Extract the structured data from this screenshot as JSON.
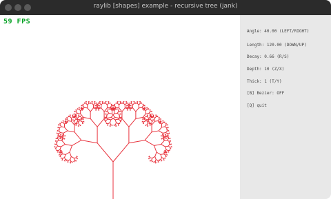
{
  "window": {
    "title": "raylib [shapes] example - recursive tree (jank)"
  },
  "fps": "59 FPS",
  "panel": {
    "lines": [
      "Angle: 40.00  (LEFT/RIGHT)",
      "Length: 120.00  (DOWN/UP)",
      "Decay: 0.66  (R/S)",
      "Depth: 10  (Z/X)",
      "Thick: 1  (T/Y)",
      "[B] Bezier: OFF",
      "[Q] quit"
    ]
  },
  "tree": {
    "angle_deg": 40,
    "length": 120,
    "decay": 0.66,
    "depth": 10,
    "thickness": 1,
    "color": "#e8323c"
  },
  "colors": {
    "titlebar": "#2b2b2b",
    "panel": "#e8e8e8",
    "fps": "#00a020"
  }
}
